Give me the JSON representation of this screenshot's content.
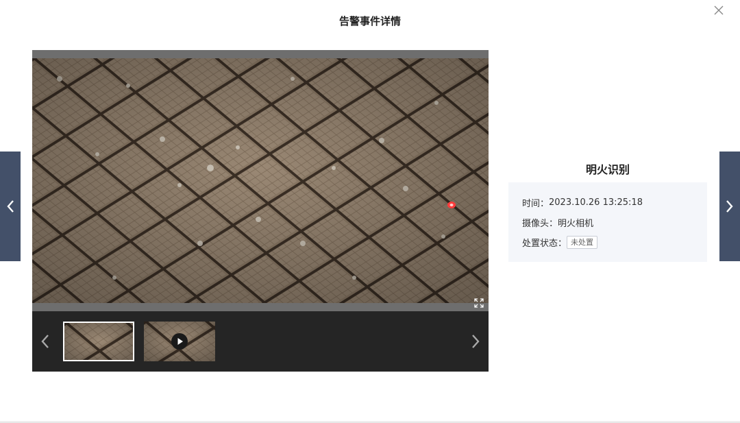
{
  "dialog": {
    "title": "告警事件详情"
  },
  "event": {
    "name": "明火识别",
    "time_label": "时间：",
    "time_value": "2023.10.26 13:25:18",
    "camera_label": "摄像头：",
    "camera_value": "明火相机",
    "status_label": "处置状态：",
    "status_value": "未处置"
  },
  "icons": {
    "close": "close-icon",
    "prev_event": "chevron-left-icon",
    "next_event": "chevron-right-icon",
    "fullscreen": "fullscreen-icon",
    "play": "play-icon"
  },
  "colors": {
    "side_arrow_bg": "#435069",
    "info_box_bg": "#f4f6fa",
    "thumb_strip_bg": "#252525",
    "fire_marker": "#ff3b3b"
  },
  "thumbnails": [
    {
      "type": "image",
      "selected": true
    },
    {
      "type": "video",
      "selected": false
    }
  ]
}
